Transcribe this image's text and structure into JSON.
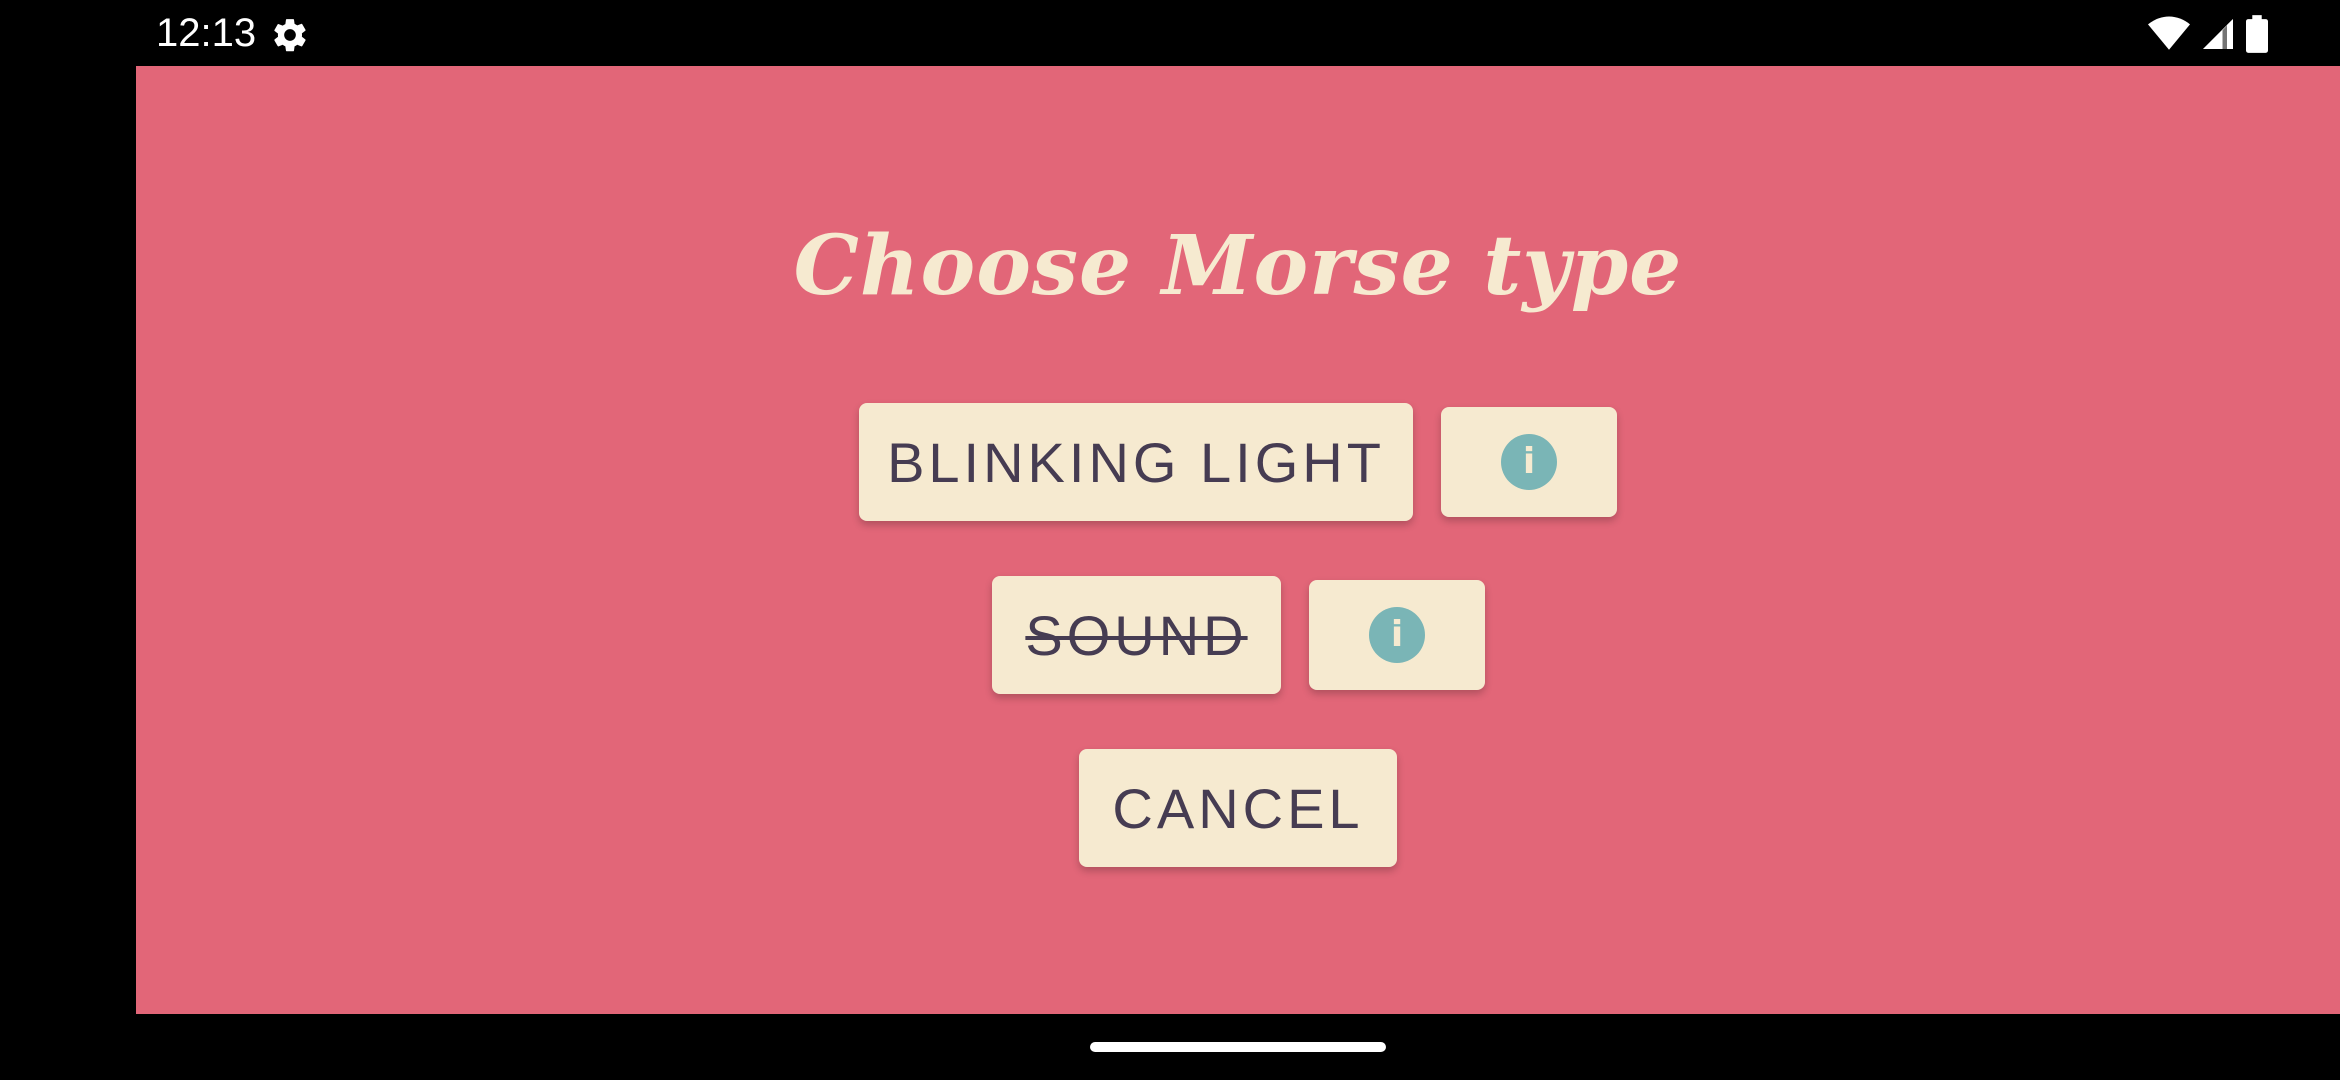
{
  "status_bar": {
    "time": "12:13",
    "icons": [
      "settings-icon",
      "wifi-icon",
      "signal-icon",
      "battery-icon"
    ]
  },
  "app": {
    "background": "#e26678",
    "title": "Choose Morse type",
    "buttons": {
      "blinking_light": "BLINKING LIGHT",
      "sound": "SOUND",
      "cancel": "CANCEL",
      "info_glyph": "i"
    },
    "colors": {
      "button_bg": "#f6ead0",
      "button_text": "#463c52",
      "info_accent": "#7ab5b6"
    }
  }
}
